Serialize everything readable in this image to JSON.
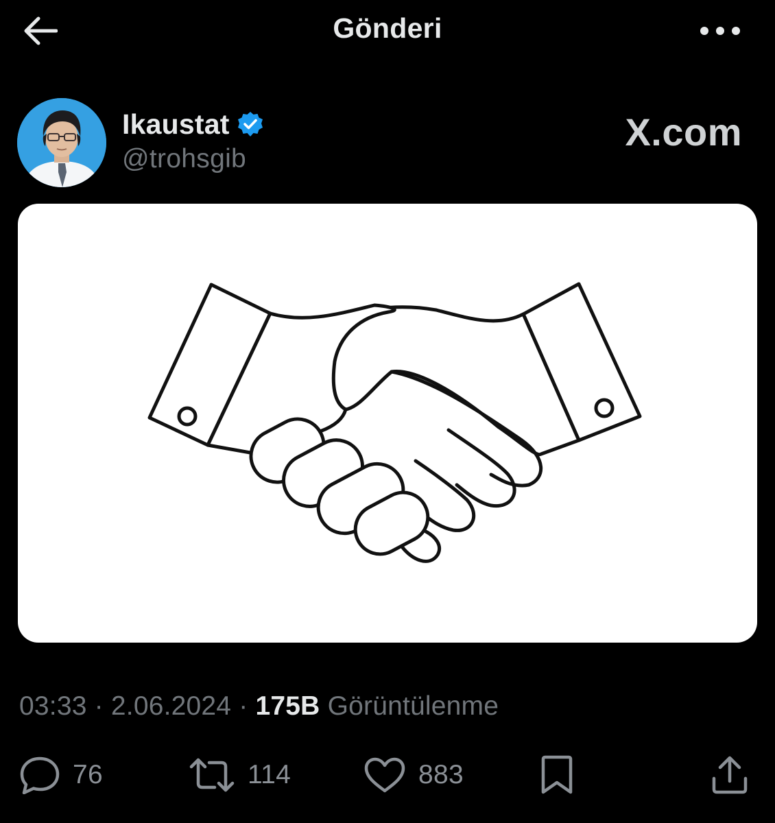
{
  "header": {
    "title": "Gönderi",
    "back_icon": "arrow-left-icon",
    "more_icon": "more-dots-icon"
  },
  "author": {
    "display_name": "Ikaustat",
    "handle": "@trohsgib",
    "verified_icon": "verified-badge-icon",
    "verified_color": "#1d9bf0"
  },
  "brand": {
    "logo_text": "X.com"
  },
  "media": {
    "image_alt": "handshake-line-drawing"
  },
  "meta": {
    "time": "03:33",
    "date": "2.06.2024",
    "separator": "·",
    "views_count": "175B",
    "views_label": "Görüntülenme"
  },
  "actions": {
    "replies": {
      "icon": "reply-icon",
      "count": "76"
    },
    "reposts": {
      "icon": "repost-icon",
      "count": "114"
    },
    "likes": {
      "icon": "heart-icon",
      "count": "883"
    },
    "bookmark": {
      "icon": "bookmark-icon"
    },
    "share": {
      "icon": "share-icon"
    }
  },
  "colors": {
    "background": "#000000",
    "primary_text": "#e7e9ea",
    "secondary_text": "#71767b",
    "accent": "#1d9bf0"
  }
}
